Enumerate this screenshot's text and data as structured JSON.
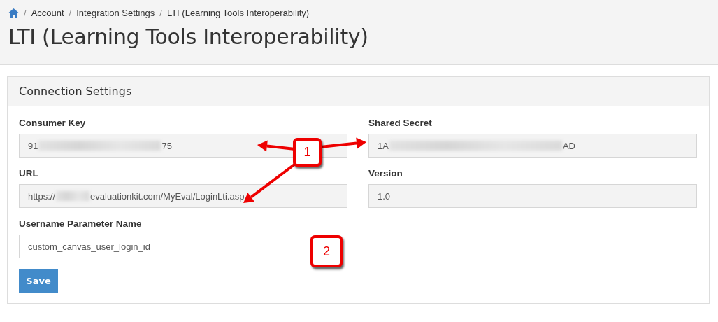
{
  "breadcrumb": {
    "separator": "/",
    "items": [
      {
        "kind": "home"
      },
      {
        "kind": "link",
        "label": "Account"
      },
      {
        "kind": "link",
        "label": "Integration Settings"
      },
      {
        "kind": "current",
        "label": "LTI (Learning Tools Interoperability)"
      }
    ]
  },
  "page_title": "LTI (Learning Tools Interoperability)",
  "panel": {
    "title": "Connection Settings",
    "fields": [
      {
        "label": "Consumer Key",
        "value_start": "91",
        "value_end": "75",
        "redacted": true,
        "readonly": true
      },
      {
        "label": "Shared Secret",
        "value_start": "1A",
        "value_end": "AD",
        "redacted": true,
        "readonly": true
      },
      {
        "label": "URL",
        "value_start": "https://",
        "value_end": "evaluationkit.com/MyEval/LoginLti.asp",
        "redacted": true,
        "readonly": true
      },
      {
        "label": "Version",
        "value_start": "1.0",
        "redacted": false,
        "readonly": true
      },
      {
        "label": "Username Parameter Name",
        "value_start": "custom_canvas_user_login_id",
        "redacted": false,
        "readonly": false
      }
    ],
    "button": "Save"
  },
  "annotations": [
    {
      "label": "1"
    },
    {
      "label": "2"
    }
  ]
}
